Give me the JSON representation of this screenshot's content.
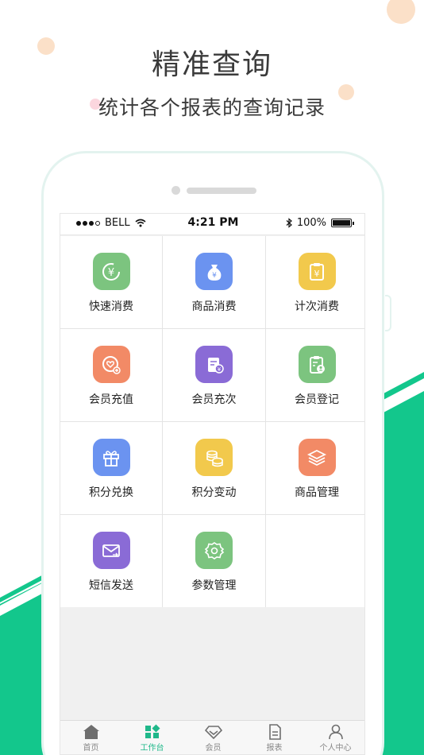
{
  "hero": {
    "title": "精准查询",
    "subtitle": "统计各个报表的查询记录"
  },
  "statusbar": {
    "carrier": "BELL",
    "time": "4:21 PM",
    "battery": "100%"
  },
  "grid": {
    "items": [
      {
        "label": "快速消费",
        "icon": "yen-refresh-icon",
        "color": "#7cc47f"
      },
      {
        "label": "商品消费",
        "icon": "money-bag-icon",
        "color": "#6b93f0"
      },
      {
        "label": "计次消费",
        "icon": "clipboard-yen-icon",
        "color": "#f2c94c"
      },
      {
        "label": "会员充值",
        "icon": "heart-plus-icon",
        "color": "#f28a66"
      },
      {
        "label": "会员充次",
        "icon": "card-yen-icon",
        "color": "#8a6bd6"
      },
      {
        "label": "会员登记",
        "icon": "clipboard-user-icon",
        "color": "#7cc47f"
      },
      {
        "label": "积分兑换",
        "icon": "gift-icon",
        "color": "#6b93f0"
      },
      {
        "label": "积分变动",
        "icon": "coins-icon",
        "color": "#f2c94c"
      },
      {
        "label": "商品管理",
        "icon": "layers-icon",
        "color": "#f28a66"
      },
      {
        "label": "短信发送",
        "icon": "mail-icon",
        "color": "#8a6bd6"
      },
      {
        "label": "参数管理",
        "icon": "gear-icon",
        "color": "#7cc47f"
      }
    ]
  },
  "tabbar": {
    "items": [
      {
        "label": "首页",
        "icon": "home-icon"
      },
      {
        "label": "工作台",
        "icon": "workbench-icon",
        "active": true
      },
      {
        "label": "会员",
        "icon": "diamond-icon"
      },
      {
        "label": "报表",
        "icon": "report-icon"
      },
      {
        "label": "个人中心",
        "icon": "person-icon"
      }
    ]
  },
  "colors": {
    "accent": "#1fb88a",
    "band_green": "#13c78c"
  }
}
